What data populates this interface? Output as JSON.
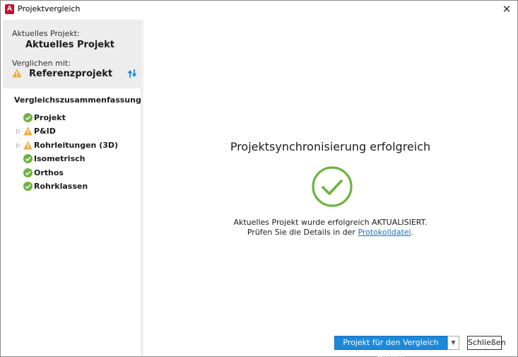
{
  "window": {
    "title": "Projektvergleich",
    "close_symbol": "✕"
  },
  "left": {
    "current_label": "Aktuelles Projekt:",
    "current_value": "Aktuelles Projekt",
    "compared_label": "Verglichen mit:",
    "compared_value": "Referenzprojekt",
    "summary_title": "Vergleichszusammenfassung",
    "tree": [
      {
        "label": "Projekt",
        "status": "ok",
        "expandable": false
      },
      {
        "label": "P&ID",
        "status": "warning",
        "expandable": true
      },
      {
        "label": "Rohrleitungen (3D)",
        "status": "warning",
        "expandable": true
      },
      {
        "label": "Isometrisch",
        "status": "ok",
        "expandable": false
      },
      {
        "label": "Orthos",
        "status": "ok",
        "expandable": false
      },
      {
        "label": "Rohrklassen",
        "status": "ok",
        "expandable": false
      }
    ]
  },
  "main": {
    "headline": "Projektsynchronisierung erfolgreich",
    "message_line1": "Aktuelles Projekt wurde erfolgreich AKTUALISIERT.",
    "message_line2_prefix": "Prüfen Sie die Details in der ",
    "message_link": "Protokolldatei",
    "message_line2_suffix": "."
  },
  "buttons": {
    "primary": "Projekt für den Vergleich wählen",
    "close": "Schließen"
  },
  "colors": {
    "success": "#6db33f",
    "warning": "#f2a93b",
    "accent": "#1e88d8",
    "link": "#1a6fc4"
  },
  "icons": {
    "app": "autodesk-app-icon",
    "ok": "check-circle-icon",
    "warning": "warning-triangle-icon",
    "swap": "swap-arrows-icon",
    "expand": "expand-triangle-icon"
  }
}
